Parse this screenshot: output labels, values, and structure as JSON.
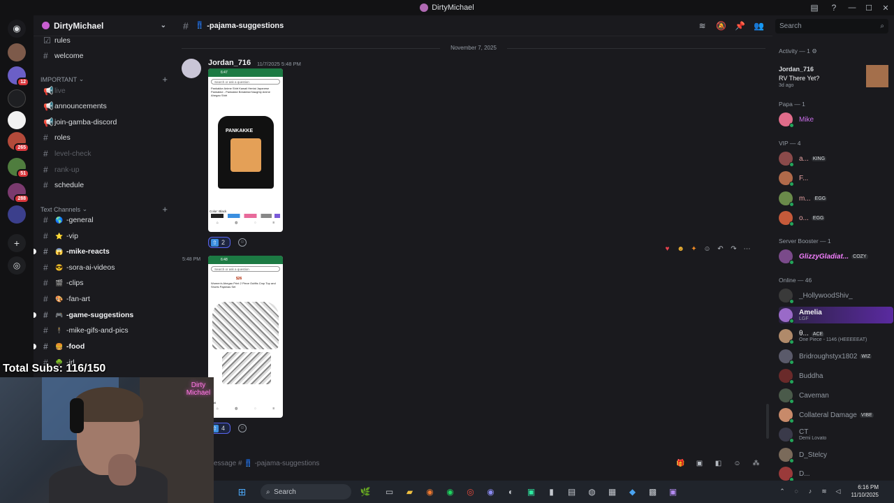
{
  "window": {
    "title": "DirtyMichael"
  },
  "servers": {
    "badges": [
      "12",
      "265",
      "51",
      "288"
    ]
  },
  "guild": {
    "name": "DirtyMichael"
  },
  "channels_top": [
    {
      "name": "rules",
      "state": "bright"
    },
    {
      "name": "welcome",
      "state": "bright"
    }
  ],
  "category_important": "IMPORTANT",
  "important_channels": [
    {
      "name": "live",
      "state": "muted",
      "icon": "megaphone-icon"
    },
    {
      "name": "announcements",
      "state": "bright",
      "icon": "megaphone-icon"
    },
    {
      "name": "join-gamba-discord",
      "state": "bright",
      "icon": "megaphone-icon"
    },
    {
      "name": "roles",
      "state": "bright",
      "icon": "hash-icon"
    },
    {
      "name": "level-check",
      "state": "muted",
      "icon": "hash-icon"
    },
    {
      "name": "rank-up",
      "state": "muted",
      "icon": "hash-icon"
    },
    {
      "name": "schedule",
      "state": "bright",
      "icon": "hash-icon"
    }
  ],
  "category_text": "Text Channels",
  "text_channels": [
    {
      "emoji": "🌎",
      "name": "-general",
      "state": "bright"
    },
    {
      "emoji": "⭐",
      "name": "-vip",
      "state": "bright"
    },
    {
      "emoji": "😱",
      "name": "-mike-reacts",
      "state": "active"
    },
    {
      "emoji": "😎",
      "name": "-sora-ai-videos",
      "state": "bright"
    },
    {
      "emoji": "🎬",
      "name": "-clips",
      "state": "bright"
    },
    {
      "emoji": "🎨",
      "name": "-fan-art",
      "state": "bright"
    },
    {
      "emoji": "🎮",
      "name": "-game-suggestions",
      "state": "active"
    },
    {
      "emoji": "🕴",
      "name": "-mike-gifs-and-pics",
      "state": "bright"
    },
    {
      "emoji": "🍔",
      "name": "-food",
      "state": "active"
    },
    {
      "emoji": "🌳",
      "name": "-irl",
      "state": "bright"
    }
  ],
  "overlay": {
    "subs_text": "Total Subs: 116/150",
    "neon_text": "Dirty Michael"
  },
  "chat": {
    "channel_name": "-pajama-suggestions",
    "channel_emoji": "👖",
    "search_placeholder": "Search",
    "date_divider": "November 7, 2025",
    "author": "Jordan_716",
    "timestamp": "11/7/2025 5:48 PM",
    "side_time": "5:48 PM",
    "shot1": {
      "status_time": "6:47",
      "search_text": "Search or ask a question",
      "product_desc": "Pankakke Anime Shirt Kawaii Hentai Japanese Pankakke - Pankakke Breakfast Naughty Anime Ahegao Shirt",
      "shirt_text": "PANKAKKE",
      "color_label": "Color: Black"
    },
    "shot2": {
      "status_time": "6:48",
      "search_text": "Search or ask a question",
      "price_text": "$26",
      "product_desc": "Women's Ahegao Print 2 Piece Outfits Crop Top and Shorts Pajamas Set",
      "bottom_text": "Bras"
    },
    "reaction1_count": "2",
    "reaction2_count": "4",
    "composer_placeholder": "essage # 👖 -pajama-suggestions"
  },
  "members": {
    "activity_header": "Activity — 1",
    "activity": {
      "name": "Jordan_716",
      "game": "RV There Yet?",
      "time": "3d ago"
    },
    "papa_header": "Papa — 1",
    "papa": [
      {
        "name": "Mike",
        "color": "#c86ee8"
      }
    ],
    "vip_header": "VIP — 4",
    "vip": [
      {
        "name": "a...",
        "tag": "KING",
        "color": "#e8a3a3"
      },
      {
        "name": "F...",
        "tag": "",
        "color": "#e8a3a3"
      },
      {
        "name": "m...",
        "tag": "EGG",
        "color": "#e8a3a3"
      },
      {
        "name": "o...",
        "tag": "EGG",
        "color": "#e8a3a3"
      }
    ],
    "booster_header": "Server Booster — 1",
    "booster": [
      {
        "name": "GlizzyGladiat...",
        "tag": "COZY",
        "color": "#f47fff"
      }
    ],
    "online_header": "Online — 46",
    "online": [
      {
        "name": "_HollywoodShiv_",
        "sub": "",
        "tag": ""
      },
      {
        "name": "Amelia",
        "sub": "LGF",
        "tag": ""
      },
      {
        "name": "θ...",
        "sub": "One Piece - 1146 (HEEEEEAT)",
        "tag": "ACE"
      },
      {
        "name": "Bridroughstyx1802",
        "sub": "",
        "tag": "WIZ"
      },
      {
        "name": "Buddha",
        "sub": "",
        "tag": ""
      },
      {
        "name": "Caveman",
        "sub": "",
        "tag": ""
      },
      {
        "name": "Collateral Damage",
        "sub": "",
        "tag": "VIBE"
      },
      {
        "name": "CT",
        "sub": "Demi Lovato",
        "tag": ""
      },
      {
        "name": "D_Stelcy",
        "sub": "",
        "tag": ""
      },
      {
        "name": "D...",
        "sub": "",
        "tag": ""
      }
    ]
  },
  "taskbar": {
    "search_label": "Search",
    "time": "6:16 PM",
    "date": "11/10/2025"
  }
}
